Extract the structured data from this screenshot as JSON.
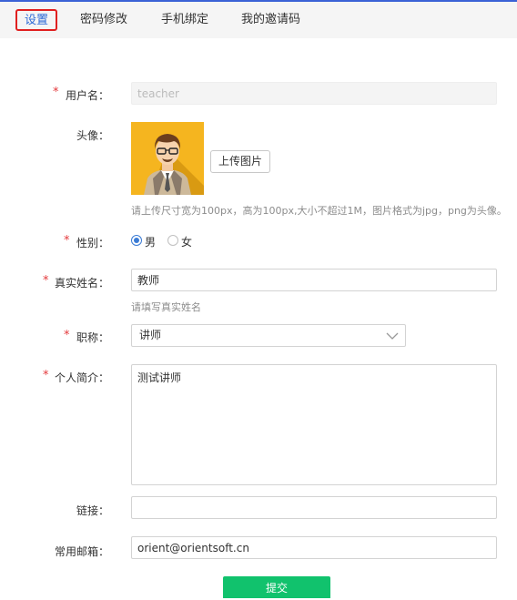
{
  "tabs": [
    {
      "label": "设置"
    },
    {
      "label": "密码修改"
    },
    {
      "label": "手机绑定"
    },
    {
      "label": "我的邀请码"
    }
  ],
  "form": {
    "required_mark": "*",
    "username": {
      "label": "用户名：",
      "value": "teacher"
    },
    "avatar": {
      "label": "头像：",
      "upload_label": "上传图片",
      "hint": "请上传尺寸宽为100px，高为100px,大小不超过1M，图片格式为jpg，png为头像。"
    },
    "gender": {
      "label": "性别：",
      "options": [
        "男",
        "女"
      ],
      "selected": "男"
    },
    "realname": {
      "label": "真实姓名：",
      "value": "教师",
      "hint": "请填写真实姓名"
    },
    "title": {
      "label": "职称：",
      "value": "讲师"
    },
    "intro": {
      "label": "个人简介：",
      "value": "测试讲师"
    },
    "link": {
      "label": "链接：",
      "value": ""
    },
    "email": {
      "label": "常用邮箱：",
      "value": "orient@orientsoft.cn"
    },
    "submit_label": "提交"
  },
  "colors": {
    "accent": "#3b62d6",
    "active_tab_border": "#e02020",
    "required": "#e4393c",
    "submit": "#11c26d",
    "avatar_bg": "#f5b51f"
  },
  "icons": {
    "avatar": "teacher-avatar-icon",
    "select": "chevron-down-icon"
  }
}
